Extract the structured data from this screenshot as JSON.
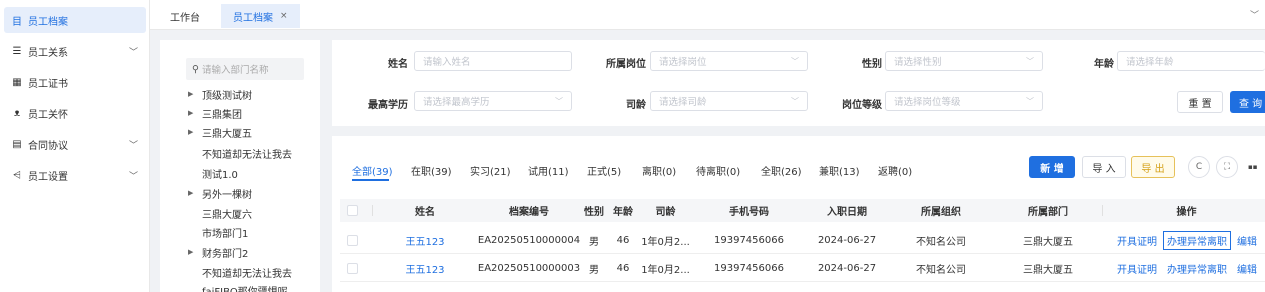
{
  "sidebar": {
    "items": [
      {
        "icon": "list-icon",
        "glyph": "目",
        "label": "员工档案",
        "active": true,
        "has_chevron": false
      },
      {
        "icon": "relation-icon",
        "glyph": "☰",
        "label": "员工关系",
        "active": false,
        "has_chevron": true
      },
      {
        "icon": "certificate-icon",
        "glyph": "▦",
        "label": "员工证书",
        "active": false,
        "has_chevron": false
      },
      {
        "icon": "care-icon",
        "glyph": "ᴥ",
        "label": "员工关怀",
        "active": false,
        "has_chevron": false
      },
      {
        "icon": "contract-icon",
        "glyph": "▤",
        "label": "合同协议",
        "active": false,
        "has_chevron": true
      },
      {
        "icon": "share-settings-icon",
        "glyph": "⩤",
        "label": "员工设置",
        "active": false,
        "has_chevron": true
      }
    ]
  },
  "tabs": [
    {
      "label": "工作台",
      "active": false
    },
    {
      "label": "员工档案",
      "active": true,
      "close": "×"
    }
  ],
  "tree": {
    "search_placeholder": "请输入部门名称",
    "nodes": [
      {
        "label": "顶级测试树",
        "expandable": true
      },
      {
        "label": "三鼎集团",
        "expandable": true
      },
      {
        "label": "三鼎大厦五",
        "expandable": true
      },
      {
        "label": "不知道却无法让我去",
        "expandable": false
      },
      {
        "label": "测试1.0",
        "expandable": false
      },
      {
        "label": "另外一棵树",
        "expandable": true
      },
      {
        "label": "三鼎大厦六",
        "expandable": false
      },
      {
        "label": "市场部门1",
        "expandable": false
      },
      {
        "label": "财务部门2",
        "expandable": true
      },
      {
        "label": "不知道却无法让我去",
        "expandable": false
      },
      {
        "label": "faiFIBO那你疆惧呢",
        "expandable": false
      }
    ]
  },
  "filters": {
    "row1": [
      {
        "label": "姓名",
        "placeholder": "请输入姓名",
        "dropdown": false
      },
      {
        "label": "所属岗位",
        "placeholder": "请选择岗位",
        "dropdown": true
      },
      {
        "label": "性别",
        "placeholder": "请选择性别",
        "dropdown": true
      },
      {
        "label": "年龄",
        "placeholder": "请选择年龄",
        "dropdown": true
      }
    ],
    "row2": [
      {
        "label": "最高学历",
        "placeholder": "请选择最高学历",
        "dropdown": true
      },
      {
        "label": "司龄",
        "placeholder": "请选择司龄",
        "dropdown": true
      },
      {
        "label": "岗位等级",
        "placeholder": "请选择岗位等级",
        "dropdown": true
      }
    ],
    "reset_label": "重 置",
    "search_label": "查 询"
  },
  "status_tabs": [
    {
      "label": "全部(39)",
      "active": true
    },
    {
      "label": "在职(39)",
      "active": false
    },
    {
      "label": "实习(21)",
      "active": false
    },
    {
      "label": "试用(11)",
      "active": false
    },
    {
      "label": "正式(5)",
      "active": false
    },
    {
      "label": "离职(0)",
      "active": false
    },
    {
      "label": "待离职(0)",
      "active": false
    },
    {
      "label": "全职(26)",
      "active": false
    },
    {
      "label": "兼职(13)",
      "active": false
    },
    {
      "label": "返聘(0)",
      "active": false
    }
  ],
  "actions": {
    "new_label": "新 增",
    "import_label": "导 入",
    "export_label": "导 出",
    "refresh_glyph": "C",
    "fullscreen_glyph": "⛶",
    "columns_glyph": "▪▪"
  },
  "table": {
    "headers": [
      "姓名",
      "档案编号",
      "性别",
      "年龄",
      "司龄",
      "手机号码",
      "入职日期",
      "所属组织",
      "所属部门",
      "操作"
    ],
    "rows": [
      {
        "name": "王五123",
        "file_no": "EA20250510000004",
        "gender": "男",
        "age": "46",
        "tenure": "1年0月2...",
        "phone": "19397456066",
        "hire_date": "2024-06-27",
        "org": "不知名公司",
        "dept": "三鼎大厦五",
        "ops": [
          "开具证明",
          "办理异常离职",
          "编辑"
        ]
      },
      {
        "name": "王五123",
        "file_no": "EA20250510000003",
        "gender": "男",
        "age": "46",
        "tenure": "1年0月2...",
        "phone": "19397456066",
        "hire_date": "2024-06-27",
        "org": "不知名公司",
        "dept": "三鼎大厦五",
        "ops": [
          "开具证明",
          "办理异常离职",
          "编辑"
        ]
      }
    ]
  },
  "colors": {
    "accent": "#1f6fe0",
    "export_border": "#e6c15a"
  }
}
